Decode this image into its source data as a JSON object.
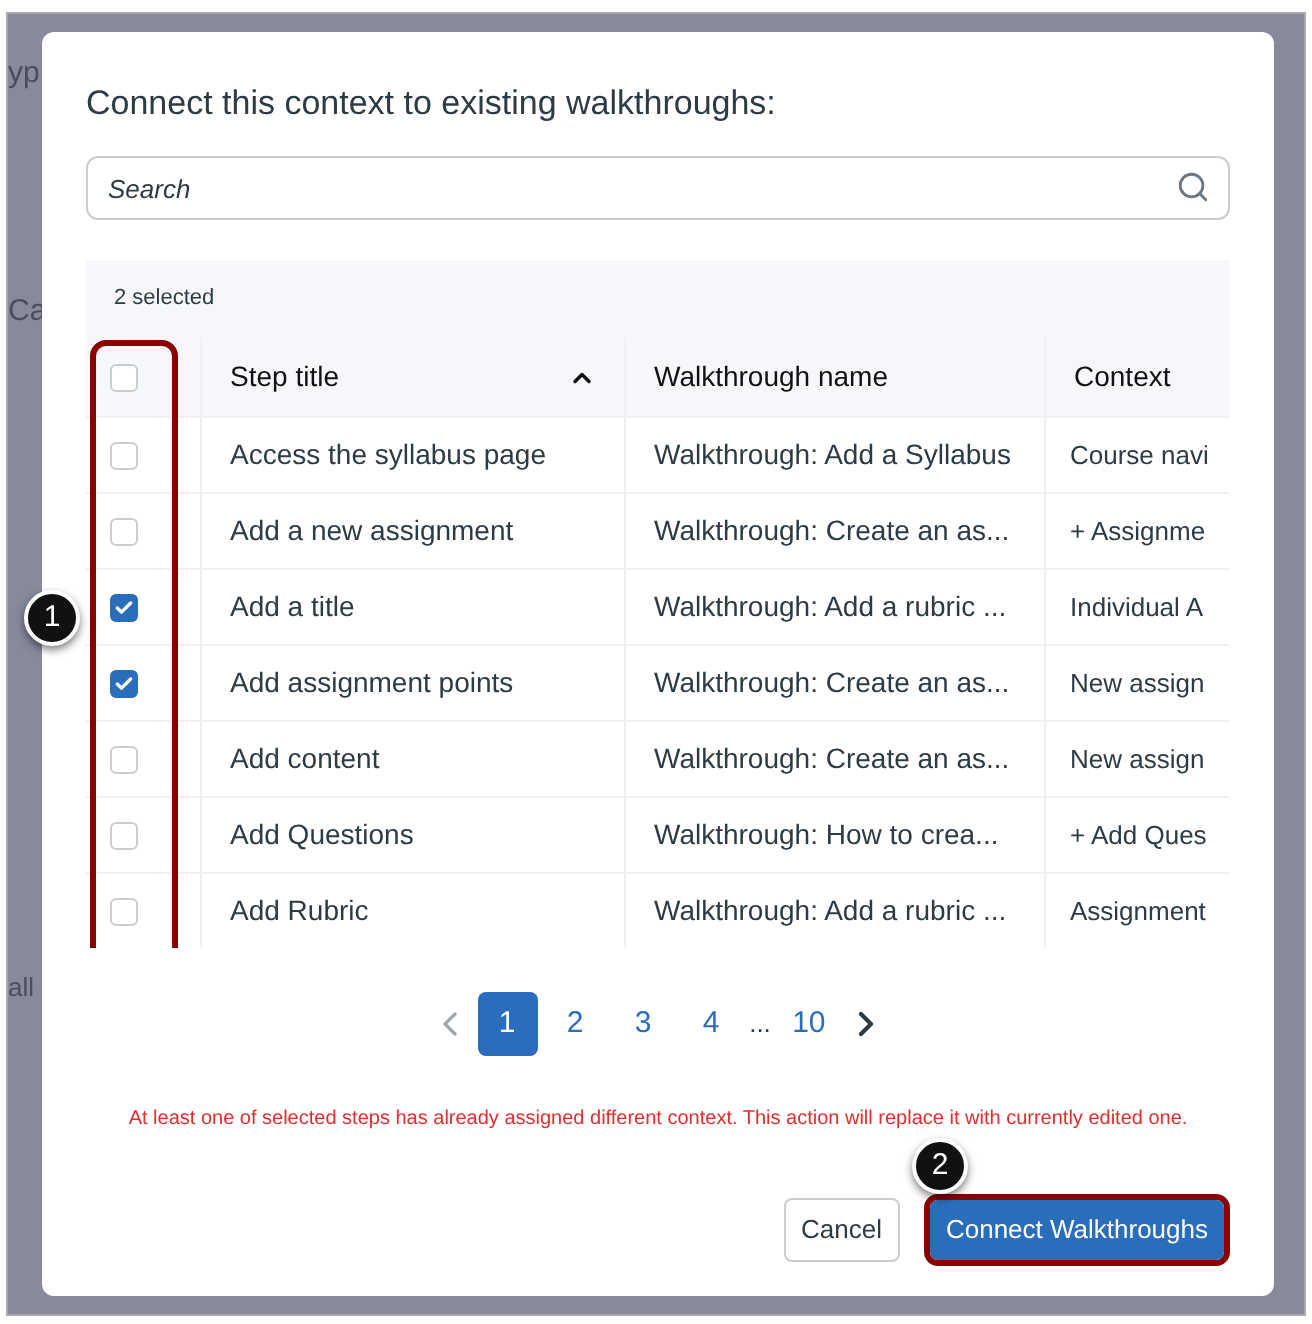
{
  "background_fragments": [
    "yp",
    "Ca",
    "all"
  ],
  "dialog": {
    "title": "Connect this context to existing walkthroughs:",
    "search": {
      "placeholder": "Search"
    },
    "table": {
      "selection_summary": "2 selected",
      "select_all": {
        "checked": false
      },
      "columns": [
        {
          "label": "Step title",
          "sorted": true
        },
        {
          "label": "Walkthrough name",
          "sorted": false
        },
        {
          "label": "Context",
          "sorted": false
        }
      ],
      "rows": [
        {
          "checked": false,
          "step_title": "Access the syllabus page",
          "walkthrough_name": "Walkthrough: Add a Syllabus",
          "context": "Course navi"
        },
        {
          "checked": false,
          "step_title": "Add a new assignment",
          "walkthrough_name": "Walkthrough: Create an as...",
          "context": "+ Assignme"
        },
        {
          "checked": true,
          "step_title": "Add a title",
          "walkthrough_name": "Walkthrough: Add a rubric ...",
          "context": "Individual A"
        },
        {
          "checked": true,
          "step_title": "Add assignment points",
          "walkthrough_name": "Walkthrough: Create an as...",
          "context": "New assign"
        },
        {
          "checked": false,
          "step_title": "Add content",
          "walkthrough_name": "Walkthrough: Create an as...",
          "context": "New assign"
        },
        {
          "checked": false,
          "step_title": "Add Questions",
          "walkthrough_name": "Walkthrough: How to crea...",
          "context": "+ Add Ques"
        },
        {
          "checked": false,
          "step_title": "Add Rubric",
          "walkthrough_name": "Walkthrough: Add a rubric ...",
          "context": "Assignment"
        }
      ]
    },
    "pagination": {
      "pages": [
        {
          "label": "1",
          "selected": true
        },
        {
          "label": "2",
          "selected": false
        },
        {
          "label": "3",
          "selected": false
        },
        {
          "label": "4",
          "selected": false
        },
        {
          "label": "...",
          "kind": "gap"
        },
        {
          "label": "10",
          "selected": false
        }
      ]
    },
    "warning": "At least one of selected steps has already assigned different context. This action will replace it with currently edited one.",
    "buttons": [
      {
        "label": "Cancel",
        "kind": "secondary"
      },
      {
        "label": "Connect Walkthroughs",
        "kind": "primary"
      }
    ]
  },
  "callouts": [
    "1",
    "2"
  ]
}
